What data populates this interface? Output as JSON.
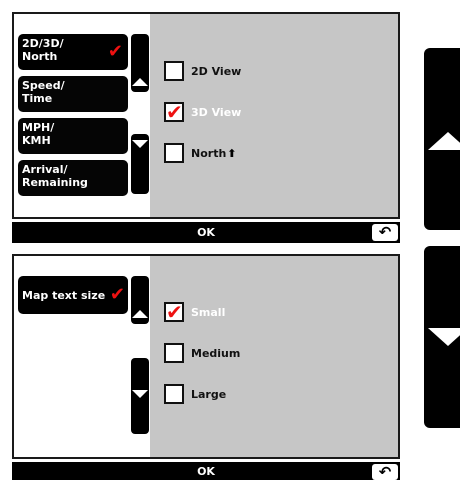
{
  "panel1": {
    "menu": [
      {
        "label": "2D/3D/\nNorth",
        "selected": true
      },
      {
        "label": "Speed/\nTime"
      },
      {
        "label": "MPH/\nKMH"
      },
      {
        "label": "Arrival/\nRemaining"
      }
    ],
    "options": [
      {
        "label": "2D View",
        "checked": false
      },
      {
        "label": "3D View",
        "checked": true
      },
      {
        "label": "North",
        "checked": false
      }
    ],
    "north_icon": "arrow-up-icon",
    "ok_label": "OK"
  },
  "panel2": {
    "menu": [
      {
        "label": "Map text size",
        "selected": true
      }
    ],
    "options": [
      {
        "label": "Small",
        "checked": true
      },
      {
        "label": "Medium",
        "checked": false
      },
      {
        "label": "Large",
        "checked": false
      }
    ],
    "ok_label": "OK"
  },
  "colors": {
    "accent": "#e11111",
    "panel_gray": "#c6c6c6",
    "black": "#000000"
  }
}
